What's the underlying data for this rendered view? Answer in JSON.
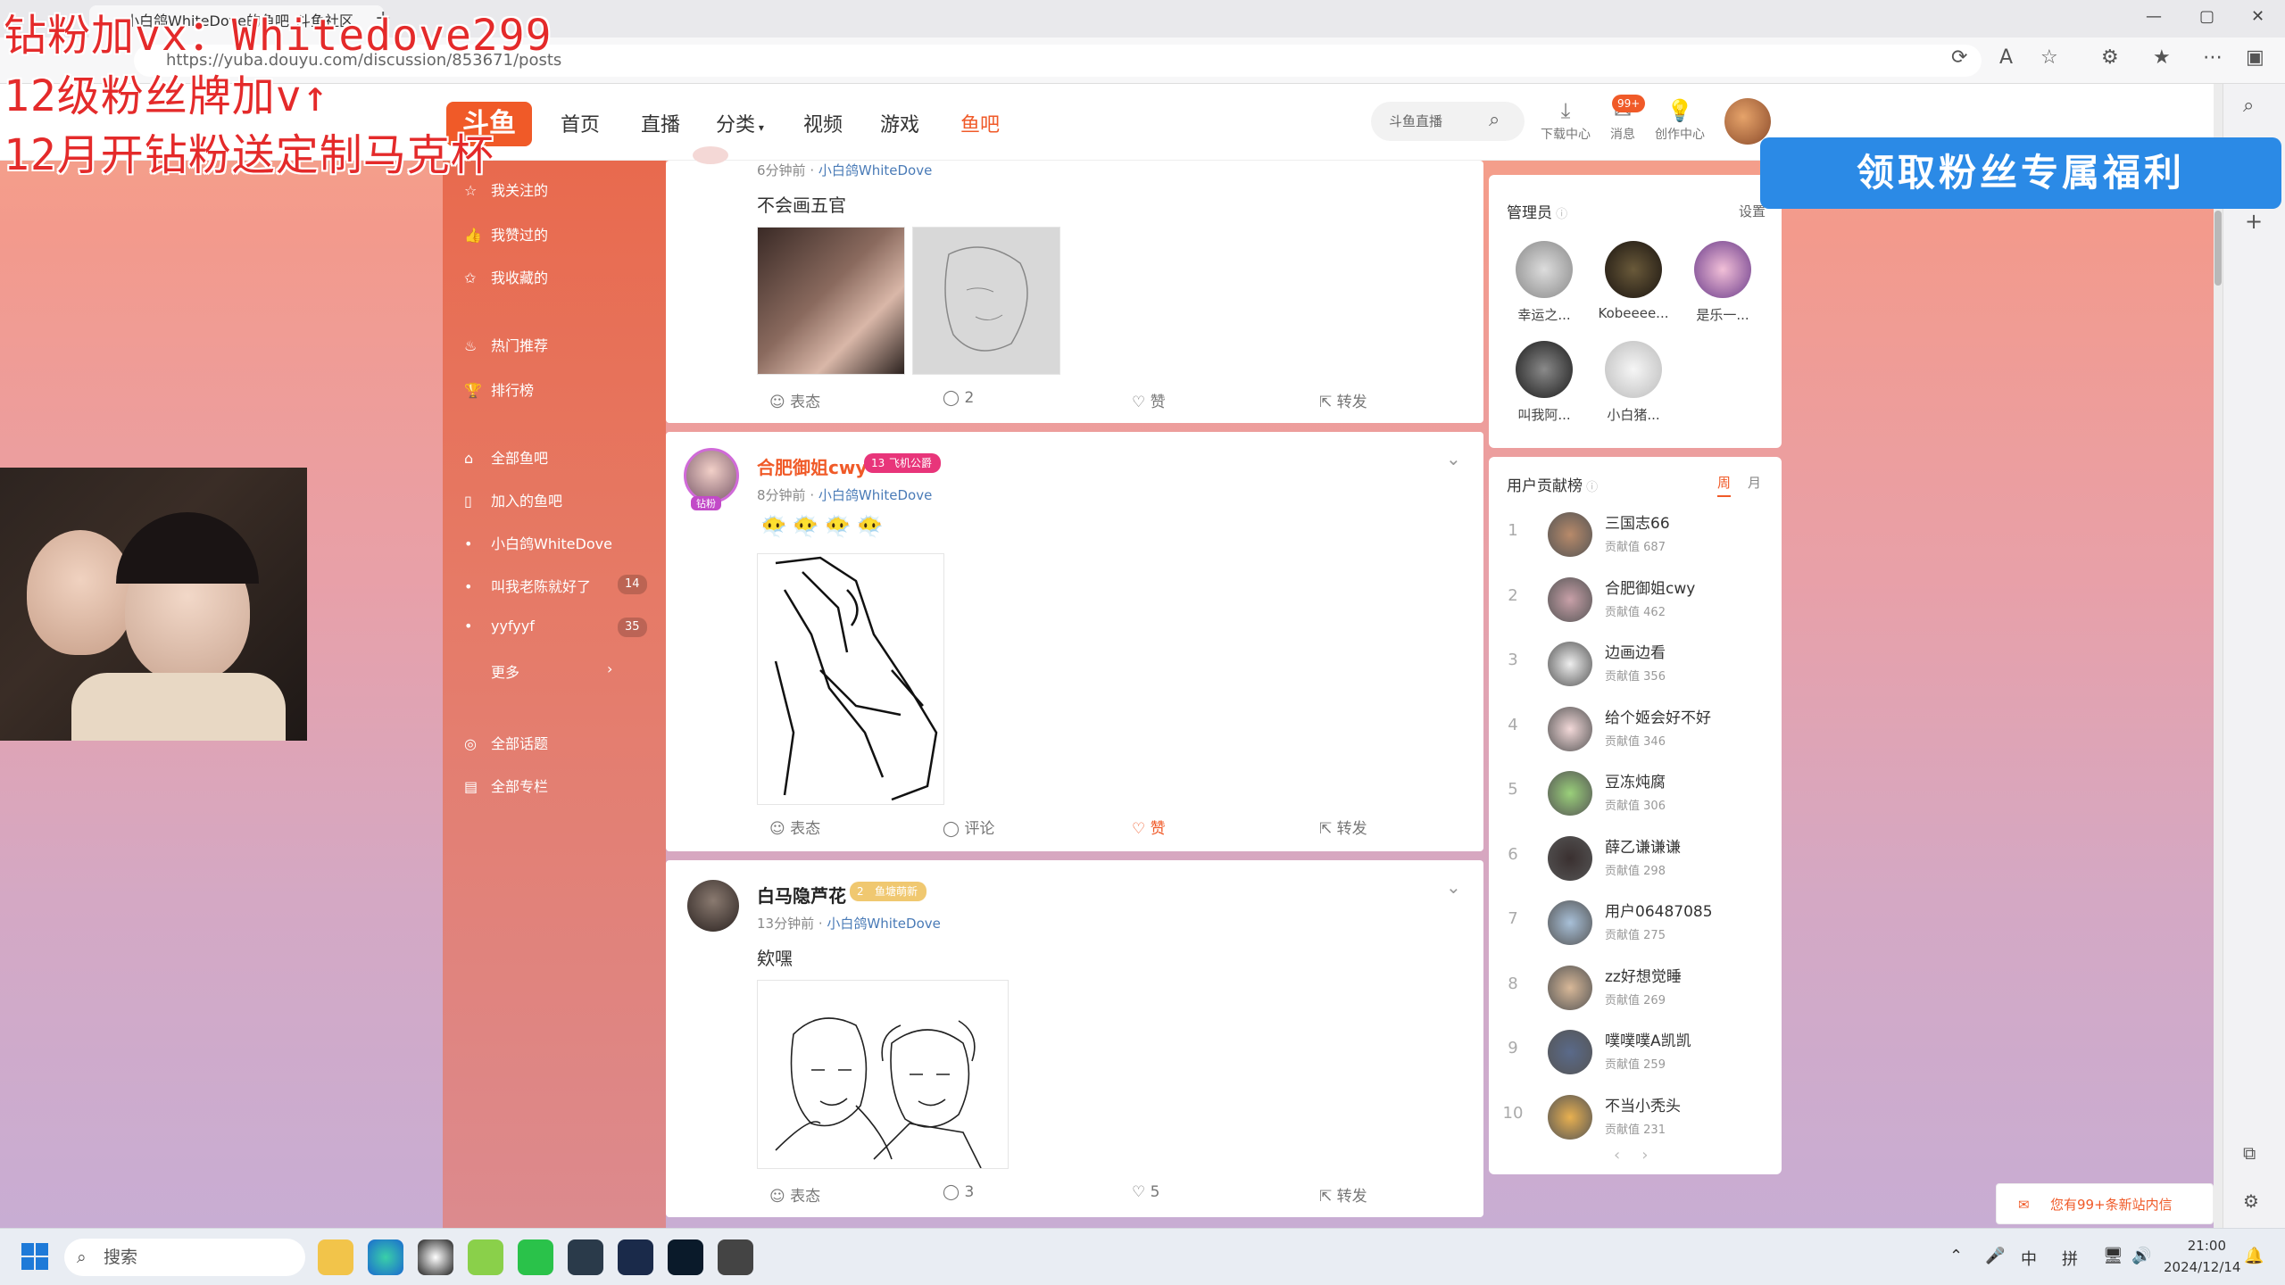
{
  "browser": {
    "tab_title": "小白鸽WhiteDove的鱼吧_斗鱼社区",
    "new_tab": "+",
    "url": "https://yuba.douyu.com/discussion/853671/posts",
    "window_min": "—",
    "window_max": "▢",
    "window_close": "✕"
  },
  "header": {
    "logo": "斗鱼",
    "nav": [
      "首页",
      "直播",
      "分类",
      "视频",
      "游戏",
      "鱼吧"
    ],
    "search_placeholder": "斗鱼直播",
    "icons": [
      {
        "label": "下载中心",
        "icon": "download-icon"
      },
      {
        "label": "消息",
        "icon": "message-icon"
      },
      {
        "label": "创作中心",
        "icon": "bulb-icon"
      }
    ],
    "message_badge": "99+"
  },
  "sidebar": {
    "items": [
      {
        "label": "我关注的",
        "icon": "star-icon"
      },
      {
        "label": "我赞过的",
        "icon": "thumb-icon"
      },
      {
        "label": "我收藏的",
        "icon": "star-outline-icon"
      },
      {
        "label": "热门推荐",
        "icon": "fire-icon"
      },
      {
        "label": "排行榜",
        "icon": "trophy-icon"
      },
      {
        "label": "全部鱼吧",
        "icon": "home-icon"
      },
      {
        "label": "加入的鱼吧",
        "icon": "bookmark-icon"
      },
      {
        "label": "小白鸽WhiteDove",
        "icon": "dot-icon"
      },
      {
        "label": "叫我老陈就好了",
        "icon": "dot-icon",
        "count": "14"
      },
      {
        "label": "yyfyyf",
        "icon": "dot-icon",
        "count": "35"
      },
      {
        "label": "更多",
        "icon": "chevron-right-icon"
      },
      {
        "label": "全部话题",
        "icon": "topic-icon"
      },
      {
        "label": "全部专栏",
        "icon": "column-icon"
      }
    ]
  },
  "posts": [
    {
      "time": "6分钟前",
      "group": "小白鸽WhiteDove",
      "text": "不会画五官",
      "actions": {
        "react": "表态",
        "comment": "2",
        "like": "赞",
        "share": "转发"
      }
    },
    {
      "user": "合肥御姐cwy",
      "badge_level": "13",
      "badge_text": "飞机公爵",
      "avatar_tag": "钻粉",
      "time": "8分钟前",
      "group": "小白鸽WhiteDove",
      "emojis": [
        "😶‍🌫️",
        "😶‍🌫️",
        "😶‍🌫️",
        "😶‍🌫️"
      ],
      "actions": {
        "react": "表态",
        "comment": "评论",
        "like": "赞",
        "share": "转发"
      }
    },
    {
      "user": "白马隐芦花",
      "badge_level": "2",
      "badge_text": "鱼塘萌新",
      "time": "13分钟前",
      "group": "小白鸽WhiteDove",
      "text": "欸嘿",
      "actions": {
        "react": "表态",
        "comment": "3",
        "like": "5",
        "share": "转发"
      }
    }
  ],
  "moderators": {
    "title": "管理员",
    "settings": "设置",
    "users": [
      "幸运之...",
      "Kobeeee...",
      "是乐一...",
      "叫我阿...",
      "小白猪..."
    ]
  },
  "ranking": {
    "title": "用户贡献榜",
    "tabs": [
      "周",
      "月"
    ],
    "value_label": "贡献值",
    "rows": [
      {
        "rank": "1",
        "name": "三国志66",
        "value": "687"
      },
      {
        "rank": "2",
        "name": "合肥御姐cwy",
        "value": "462"
      },
      {
        "rank": "3",
        "name": "边画边看",
        "value": "356"
      },
      {
        "rank": "4",
        "name": "给个姬会好不好",
        "value": "346"
      },
      {
        "rank": "5",
        "name": "豆冻炖腐",
        "value": "306"
      },
      {
        "rank": "6",
        "name": "薛乙谦谦谦",
        "value": "298"
      },
      {
        "rank": "7",
        "name": "用户06487085",
        "value": "275"
      },
      {
        "rank": "8",
        "name": "zz好想觉睡",
        "value": "269"
      },
      {
        "rank": "9",
        "name": "噗噗噗A凯凯",
        "value": "259"
      },
      {
        "rank": "10",
        "name": "不当小秃头",
        "value": "231"
      }
    ],
    "pager": [
      "‹",
      "›"
    ]
  },
  "overlay": {
    "line1": "钻粉加vx：Whitedove299",
    "line2": "12级粉丝牌加v↑",
    "line3": "12月开钻粉送定制马克杯",
    "promo": "领取粉丝专属福利"
  },
  "notification": "您有99+条新站内信",
  "taskbar": {
    "search": "搜索",
    "time": "21:00",
    "date": "2024/12/14",
    "ime1": "中",
    "ime2": "拼"
  },
  "colors": {
    "accent": "#f05a28",
    "link": "#4a7bb7",
    "promo": "#2b8ae6",
    "sidebar": "#e86a4e"
  }
}
